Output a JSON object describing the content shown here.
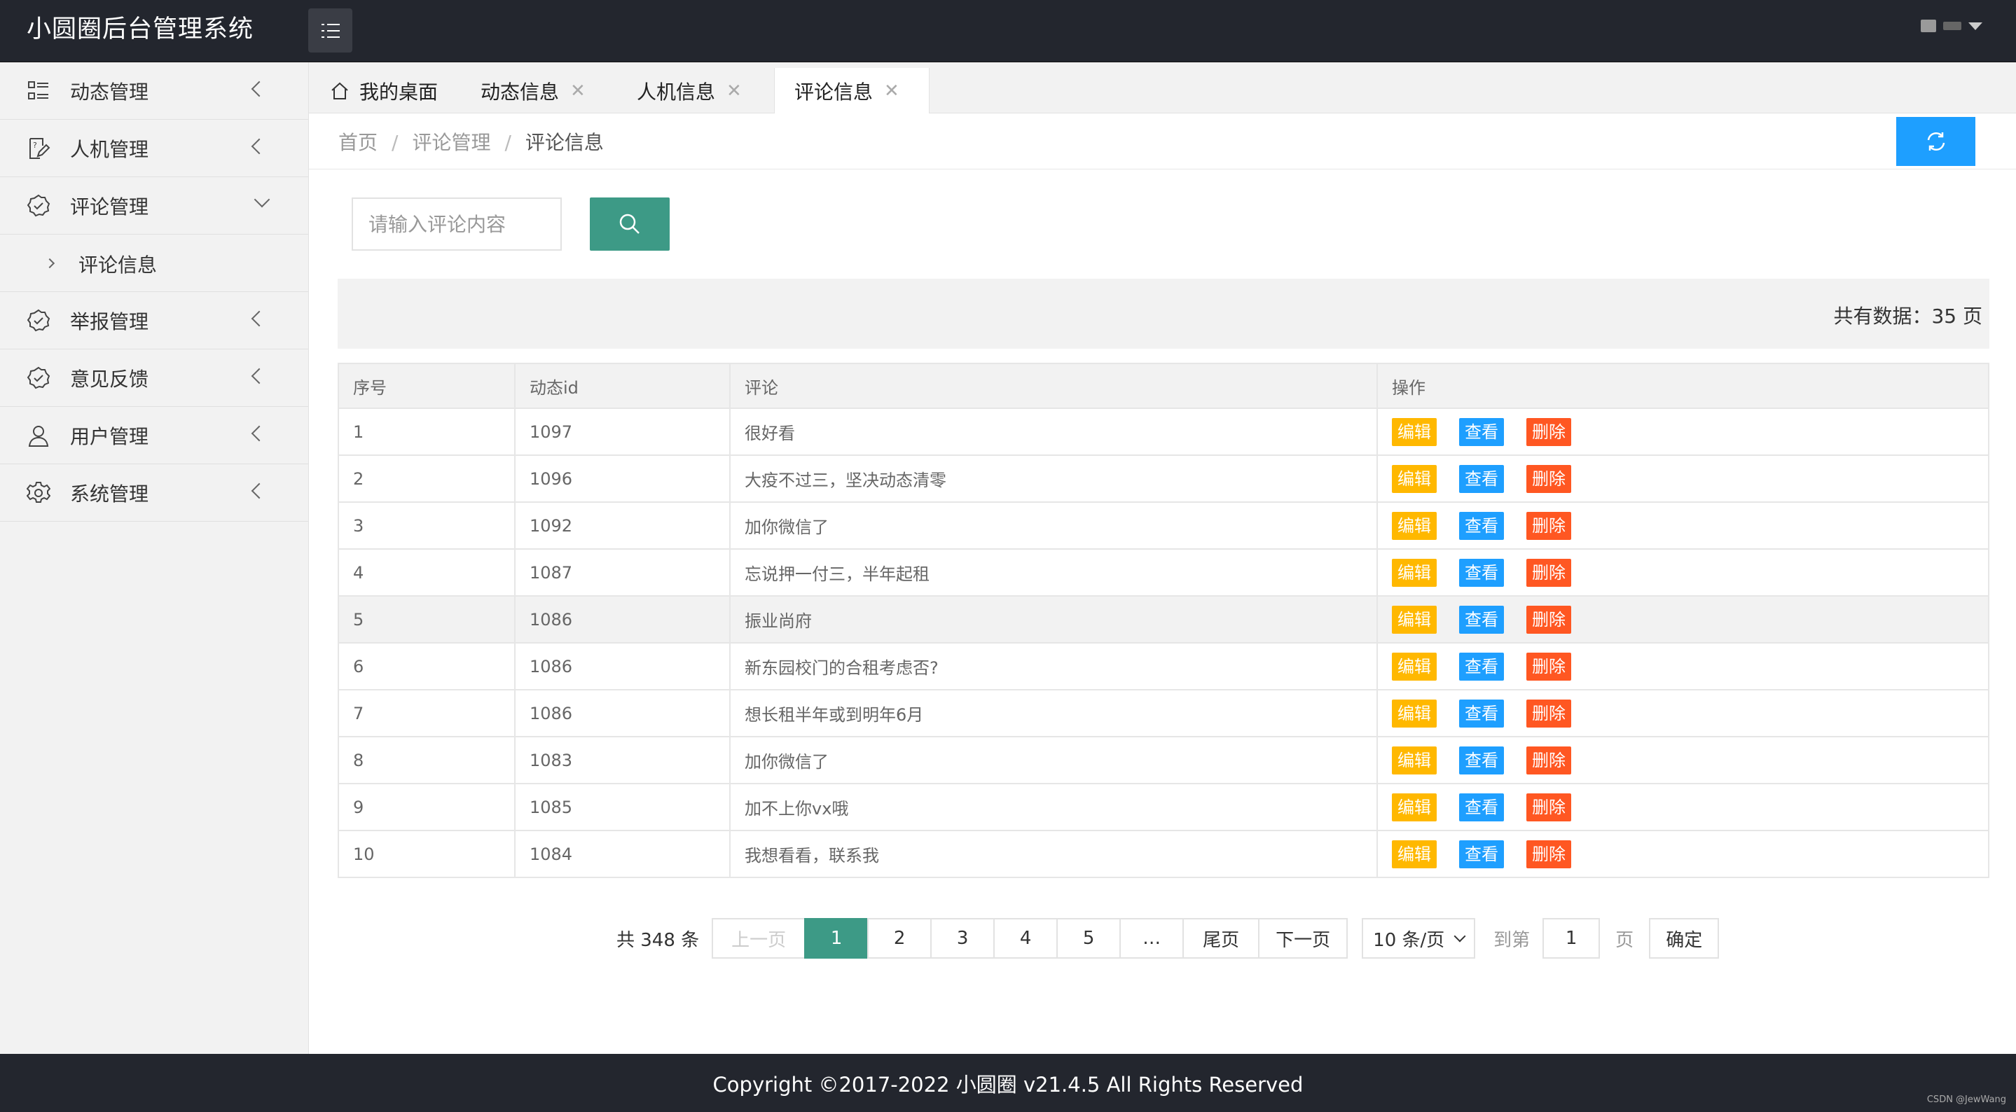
{
  "header": {
    "title": "小圆圈后台管理系统"
  },
  "sidebar": {
    "items": [
      {
        "label": "动态管理",
        "icon": "list-icon"
      },
      {
        "label": "人机管理",
        "icon": "edit-doc-icon"
      },
      {
        "label": "评论管理",
        "icon": "check-badge-icon"
      },
      {
        "label": "举报管理",
        "icon": "check-badge-icon"
      },
      {
        "label": "意见反馈",
        "icon": "check-badge-icon"
      },
      {
        "label": "用户管理",
        "icon": "user-icon"
      },
      {
        "label": "系统管理",
        "icon": "gear-icon"
      }
    ],
    "sub_item": "评论信息"
  },
  "tabs": [
    {
      "label": "我的桌面"
    },
    {
      "label": "动态信息"
    },
    {
      "label": "人机信息"
    },
    {
      "label": "评论信息"
    }
  ],
  "tab_close": "✕",
  "breadcrumb": {
    "home": "首页",
    "section": "评论管理",
    "current": "评论信息",
    "sep": "/"
  },
  "search": {
    "placeholder": "请输入评论内容"
  },
  "summary": {
    "text": "共有数据：35 页"
  },
  "table": {
    "headers": [
      "序号",
      "动态id",
      "评论",
      "操作"
    ],
    "actions": {
      "edit": "编辑",
      "view": "查看",
      "delete": "删除"
    },
    "rows": [
      {
        "no": "1",
        "post_id": "1097",
        "comment": "很好看"
      },
      {
        "no": "2",
        "post_id": "1096",
        "comment": "大疫不过三，坚决动态清零"
      },
      {
        "no": "3",
        "post_id": "1092",
        "comment": "加你微信了"
      },
      {
        "no": "4",
        "post_id": "1087",
        "comment": "忘说押一付三，半年起租"
      },
      {
        "no": "5",
        "post_id": "1086",
        "comment": "振业尚府"
      },
      {
        "no": "6",
        "post_id": "1086",
        "comment": "新东园校门的合租考虑否?"
      },
      {
        "no": "7",
        "post_id": "1086",
        "comment": "想长租半年或到明年6月"
      },
      {
        "no": "8",
        "post_id": "1083",
        "comment": "加你微信了"
      },
      {
        "no": "9",
        "post_id": "1085",
        "comment": "加不上你vx哦"
      },
      {
        "no": "10",
        "post_id": "1084",
        "comment": "我想看看，联系我"
      }
    ]
  },
  "pagination": {
    "total": "共 348 条",
    "prev": "上一页",
    "pages": [
      "1",
      "2",
      "3",
      "4",
      "5"
    ],
    "ellipsis": "…",
    "last": "尾页",
    "next": "下一页",
    "limit": "10 条/页",
    "goto_label": "到第",
    "goto_value": "1",
    "goto_unit": "页",
    "confirm": "确定"
  },
  "footer": {
    "copyright": "Copyright ©2017-2022 小圆圈 v21.4.5 All Rights Reserved",
    "watermark": "CSDN @JewWang"
  },
  "colors": {
    "header_bg": "#23262e",
    "primary_green": "#3d9a86",
    "blue": "#1e9fff",
    "orange": "#ffb800",
    "red": "#ff5722"
  }
}
